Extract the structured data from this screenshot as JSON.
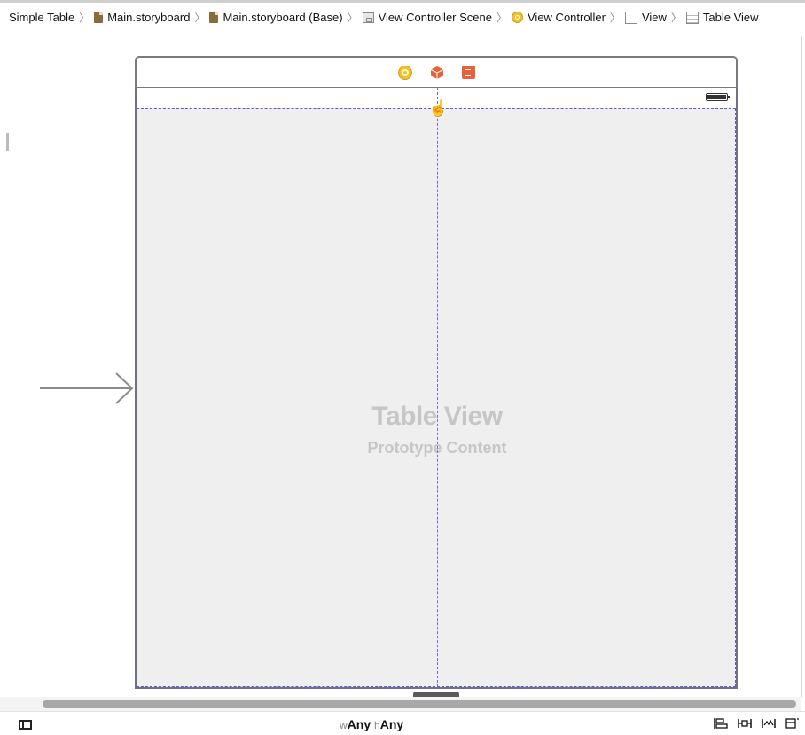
{
  "breadcrumb": {
    "items": [
      {
        "label": "Simple Table",
        "icon": "none"
      },
      {
        "label": "Main.storyboard",
        "icon": "storyboard-file-icon"
      },
      {
        "label": "Main.storyboard (Base)",
        "icon": "storyboard-file-icon"
      },
      {
        "label": "View Controller Scene",
        "icon": "scene-icon"
      },
      {
        "label": "View Controller",
        "icon": "view-controller-icon"
      },
      {
        "label": "View",
        "icon": "view-icon"
      },
      {
        "label": "Table View",
        "icon": "table-view-icon"
      }
    ],
    "separator": "〉"
  },
  "scene": {
    "dock_icons": [
      "view-controller-icon",
      "first-responder-icon",
      "exit-icon"
    ],
    "table_view": {
      "title": "Table View",
      "subtitle": "Prototype Content"
    }
  },
  "bottom_bar": {
    "w_prefix": "w",
    "w_value": "Any",
    "h_prefix": "h",
    "h_value": "Any",
    "tools": [
      "align-icon",
      "pin-icon",
      "resolve-issues-icon",
      "resizing-behavior-icon"
    ]
  },
  "colors": {
    "selection_guide": "#5b5bd0",
    "table_background": "#efefef",
    "vc_icon": "#f2c227",
    "exit_icon": "#e8613a"
  }
}
